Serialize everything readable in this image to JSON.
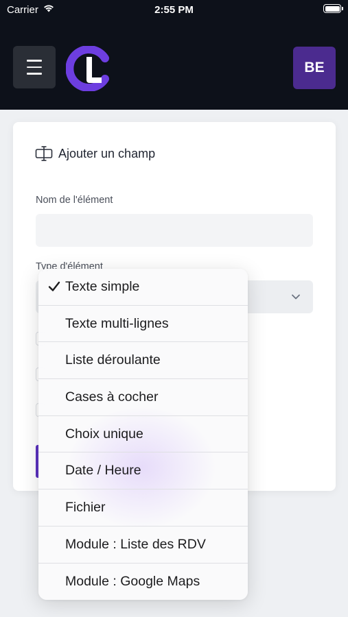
{
  "status_bar": {
    "carrier": "Carrier",
    "time": "2:55 PM"
  },
  "header": {
    "avatar_initials": "BE",
    "brand_color": "#5b32c0"
  },
  "form": {
    "title": "Ajouter un champ",
    "name_label": "Nom de l'élément",
    "name_value": "",
    "type_label": "Type d'élément",
    "type_selected": "Texte simple"
  },
  "dropdown": {
    "items": [
      {
        "label": "Texte simple",
        "selected": true
      },
      {
        "label": "Texte multi-lignes",
        "selected": false
      },
      {
        "label": "Liste déroulante",
        "selected": false
      },
      {
        "label": "Cases à cocher",
        "selected": false
      },
      {
        "label": "Choix unique",
        "selected": false
      },
      {
        "label": "Date / Heure",
        "selected": false
      },
      {
        "label": "Fichier",
        "selected": false
      },
      {
        "label": "Module : Liste des RDV",
        "selected": false
      },
      {
        "label": "Module : Google Maps",
        "selected": false
      }
    ]
  },
  "icons": {
    "menu": "hamburger-menu-icon",
    "title": "text-cursor-icon",
    "select": "chevron-down-icon",
    "check": "checkmark-icon"
  }
}
